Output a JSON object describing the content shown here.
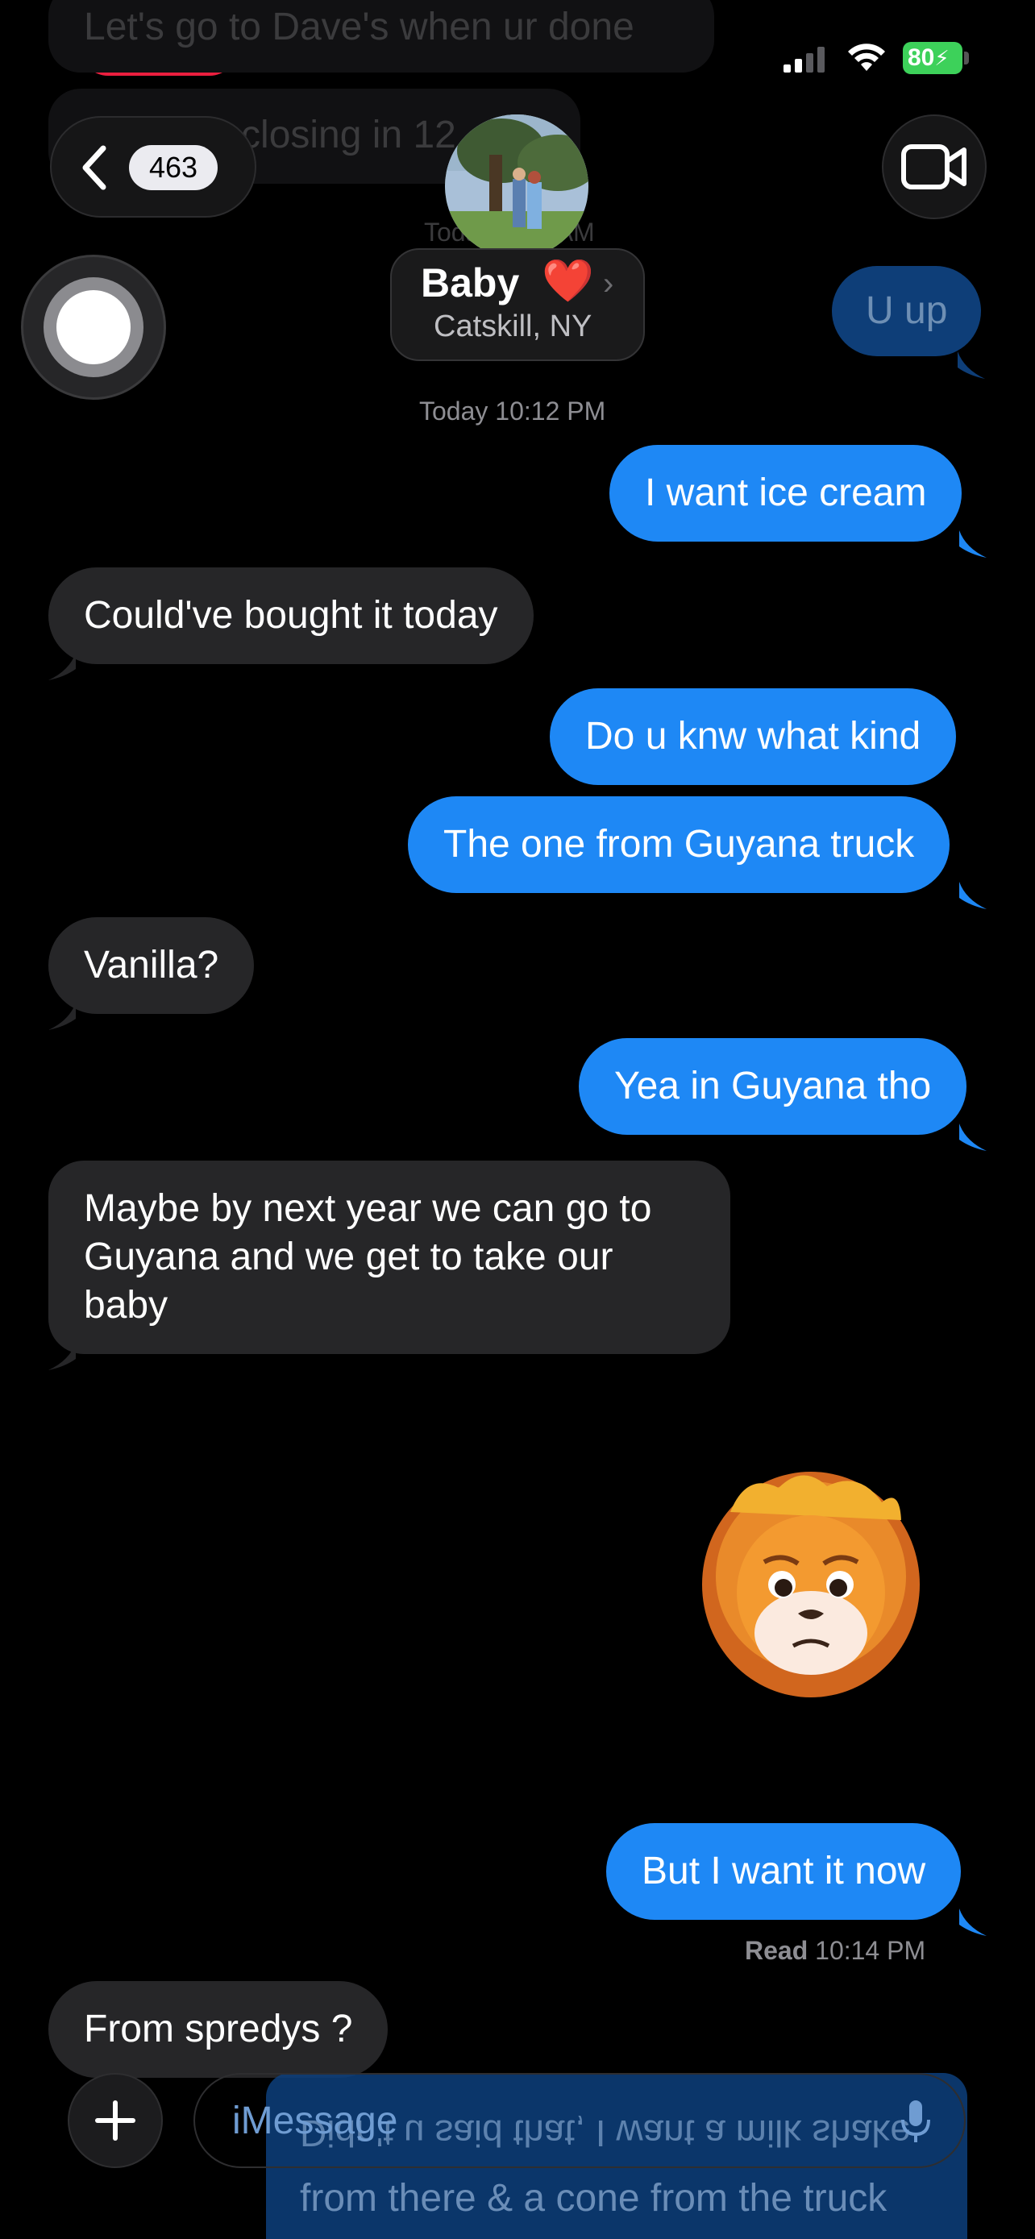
{
  "status_bar": {
    "battery": "80",
    "icons": [
      "recording-indicator-icon",
      "cellular-signal-icon",
      "wifi-icon",
      "battery-charging-icon"
    ]
  },
  "ghost_messages": {
    "line1": "Let's go to Dave's when ur done",
    "line2": "Wendy's closing in 12",
    "stamp": "Today 9:58 AM"
  },
  "header": {
    "back_count": "463",
    "contact_name": "Baby",
    "contact_emoji": "❤️",
    "contact_location": "Catskill, NY"
  },
  "faded_sent": "U up",
  "timestamp1": "Today 10:12 PM",
  "messages": [
    {
      "id": "m1",
      "dir": "sent",
      "text": "I want ice cream"
    },
    {
      "id": "m2",
      "dir": "recv",
      "text": "Could've bought it today"
    },
    {
      "id": "m3",
      "dir": "sent",
      "text": "Do u knw what kind"
    },
    {
      "id": "m4",
      "dir": "sent",
      "text": "The one from Guyana truck"
    },
    {
      "id": "m5",
      "dir": "recv",
      "text": "Vanilla?"
    },
    {
      "id": "m6",
      "dir": "sent",
      "text": "Yea in Guyana tho"
    },
    {
      "id": "m7",
      "dir": "recv",
      "text": "Maybe by next year we can go to Guyana and we get to take our baby"
    },
    {
      "id": "m8",
      "dir": "sent",
      "text": "But I want it now"
    },
    {
      "id": "m9",
      "dir": "recv",
      "text": "From spredys ?"
    }
  ],
  "read_receipt": {
    "label": "Read",
    "time": "10:14 PM"
  },
  "composer": {
    "placeholder": "iMessage",
    "reveal_line1": "Didn't u said that, I want a milk shake",
    "reveal_line2": "from there & a cone from the truck"
  },
  "colors": {
    "sent": "#1e88f5",
    "received": "#262628",
    "background": "#000000"
  }
}
